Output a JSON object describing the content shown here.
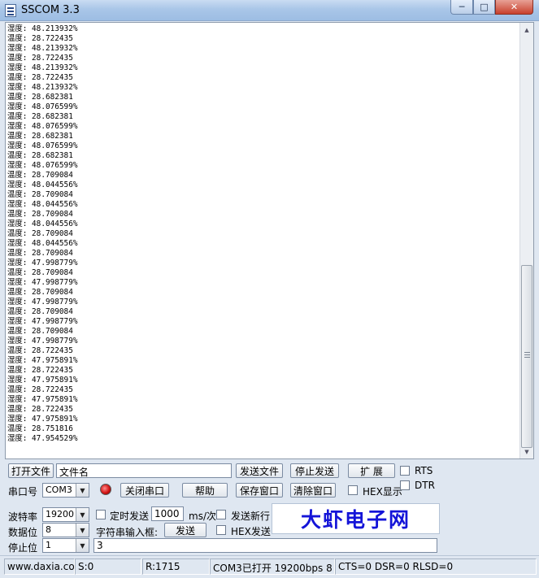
{
  "window": {
    "title": "SSCOM 3.3",
    "minimize_glyph": "─",
    "maximize_glyph": "□",
    "close_glyph": "✕"
  },
  "output_lines": [
    "湿度: 48.213932%",
    "温度: 28.722435",
    "湿度: 48.213932%",
    "温度: 28.722435",
    "湿度: 48.213932%",
    "温度: 28.722435",
    "湿度: 48.213932%",
    "温度: 28.682381",
    "湿度: 48.076599%",
    "温度: 28.682381",
    "湿度: 48.076599%",
    "温度: 28.682381",
    "湿度: 48.076599%",
    "温度: 28.682381",
    "湿度: 48.076599%",
    "温度: 28.709084",
    "湿度: 48.044556%",
    "温度: 28.709084",
    "湿度: 48.044556%",
    "温度: 28.709084",
    "湿度: 48.044556%",
    "温度: 28.709084",
    "湿度: 48.044556%",
    "温度: 28.709084",
    "湿度: 47.998779%",
    "温度: 28.709084",
    "湿度: 47.998779%",
    "温度: 28.709084",
    "湿度: 47.998779%",
    "温度: 28.709084",
    "湿度: 47.998779%",
    "温度: 28.709084",
    "湿度: 47.998779%",
    "温度: 28.722435",
    "湿度: 47.975891%",
    "温度: 28.722435",
    "湿度: 47.975891%",
    "温度: 28.722435",
    "湿度: 47.975891%",
    "温度: 28.722435",
    "湿度: 47.975891%",
    "温度: 28.751816",
    "湿度: 47.954529%"
  ],
  "row1": {
    "open_file": "打开文件",
    "file_name": "文件名",
    "send_file": "发送文件",
    "stop_send": "停止发送",
    "expand": "扩 展",
    "rts": "RTS"
  },
  "row2": {
    "port_label": "串口号",
    "port_value": "COM3",
    "close_port": "关闭串口",
    "help": "帮助",
    "save_window": "保存窗口",
    "clear_window": "清除窗口",
    "hex_display": "HEX显示",
    "dtr": "DTR"
  },
  "row3": {
    "baud_label": "波特率",
    "baud_value": "19200",
    "timed_send": "定时发送",
    "interval_value": "1000",
    "interval_unit": "ms/次",
    "send_newline": "发送新行"
  },
  "row4": {
    "databits_label": "数据位",
    "databits_value": "8",
    "string_input": "字符串输入框:",
    "send": "发送",
    "hex_send": "HEX发送"
  },
  "row5": {
    "stopbits_label": "停止位",
    "stopbits_value": "1",
    "input_value": "3"
  },
  "brand": "大虾电子网",
  "status": {
    "website": "www.daxia.com",
    "sent": "S:0",
    "received": "R:1715",
    "port_state": "COM3已打开  19200bps  8",
    "lines": "CTS=0 DSR=0 RLSD=0"
  },
  "colors": {
    "brand_text": "#1414d8",
    "led": "#d21414"
  }
}
